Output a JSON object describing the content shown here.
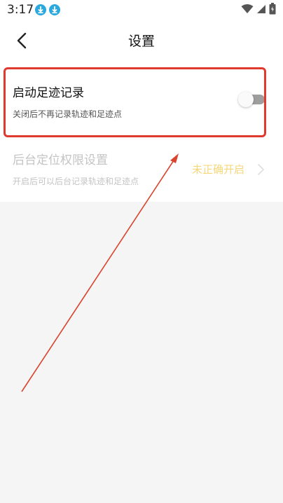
{
  "status_bar": {
    "time": "3:17"
  },
  "header": {
    "title": "设置"
  },
  "settings": [
    {
      "title": "启动足迹记录",
      "subtitle": "关闭后不再记录轨迹和足迹点",
      "toggle_on": false
    },
    {
      "title": "后台定位权限设置",
      "subtitle": "开启后可以后台记录轨迹和足迹点",
      "status": "未正确开启"
    }
  ],
  "colors": {
    "highlight": "#e03a2e",
    "status_text": "#f5d77a",
    "faded_text": "#c4c4c4",
    "toggle_track": "#9e9e9e",
    "download_badge": "#2aa8e0"
  },
  "icons": [
    "download-icon",
    "wifi-icon",
    "signal-icon",
    "battery-icon",
    "back-arrow-icon",
    "chevron-right-icon",
    "annotation-arrow"
  ]
}
